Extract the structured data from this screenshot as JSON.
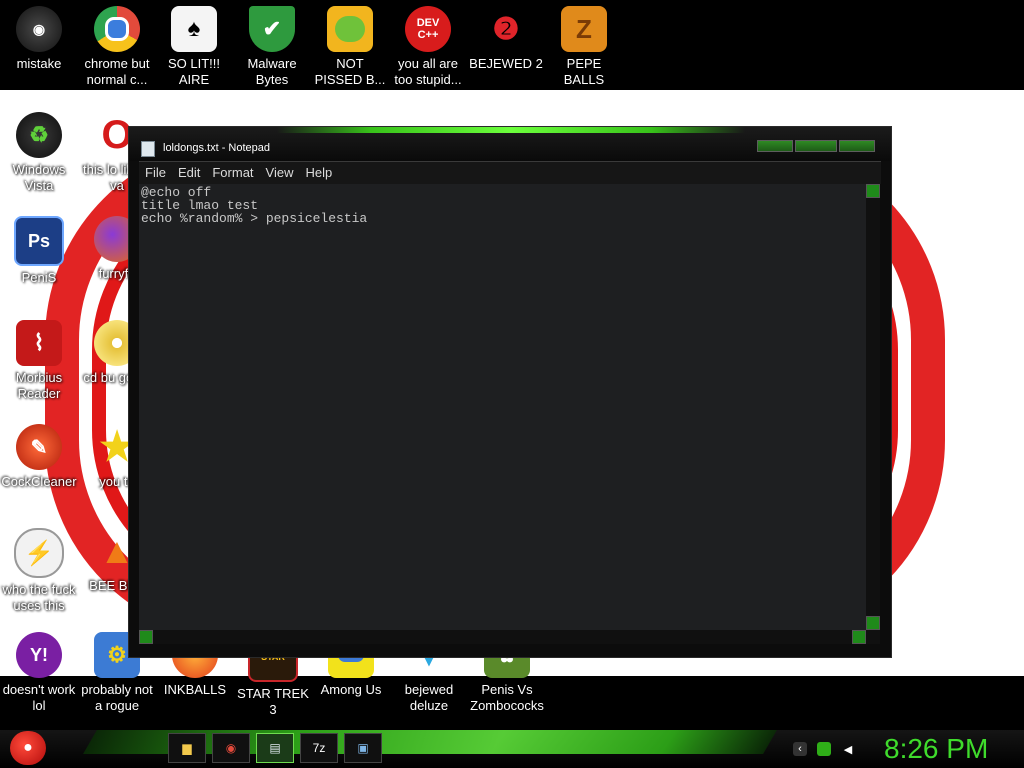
{
  "desktop": {
    "top_row": [
      {
        "label": "mistake",
        "icon": "dark-sphere-icon",
        "color": "#3a3a3a"
      },
      {
        "label": "chrome but normal c...",
        "icon": "chrome-icon",
        "color": "#e24a3b"
      },
      {
        "label": "SO LIT!!! AIRE",
        "icon": "solitaire-card-icon",
        "color": "#ffffff"
      },
      {
        "label": "Malware Bytes",
        "icon": "shield-check-icon",
        "color": "#2e9a3e"
      },
      {
        "label": "NOT PISSED B...",
        "icon": "angry-pig-icon",
        "color": "#f2b51e"
      },
      {
        "label": "you all are too stupid...",
        "icon": "devcpp-icon",
        "color": "#d81c1c"
      },
      {
        "label": "BEJEWED 2",
        "icon": "bejeweled-gem-icon",
        "color": "#2d66d1"
      },
      {
        "label": "PEPE BALLS",
        "icon": "zuma-icon",
        "color": "#e08a1b"
      }
    ],
    "left_col": [
      {
        "label": "Windows Vista",
        "icon": "recycle-bin-icon",
        "color": "#2f2f2f"
      },
      {
        "label": "PeniS",
        "icon": "photoshop-icon",
        "color": "#1c3e86"
      },
      {
        "label": "Morbius Reader",
        "icon": "acrobat-icon",
        "color": "#c41919"
      },
      {
        "label": "CockCleaner",
        "icon": "ccleaner-icon",
        "color": "#d93a1c"
      },
      {
        "label": "who the fuck uses this",
        "icon": "flash-icon",
        "color": "#e8e8e8"
      }
    ],
    "second_col": [
      {
        "label": "this lo like a va",
        "icon": "opera-icon",
        "color": "#d51b1b"
      },
      {
        "label": "furryfo",
        "icon": "firefox-icon",
        "color": "#e56a17"
      },
      {
        "label": "cd bu golde",
        "icon": "cd-icon",
        "color": "#e6c23b"
      },
      {
        "label": "you tri",
        "icon": "star-icon",
        "color": "#f2d21b"
      },
      {
        "label": "BEE BEE",
        "icon": "vlc-cone-icon",
        "color": "#f07b16"
      }
    ],
    "bottom_row": [
      {
        "label": "doesn't work lol",
        "icon": "yahoo-icon",
        "color": "#7a1fa3"
      },
      {
        "label": "probably not a rogue",
        "icon": "gear-monitor-icon",
        "color": "#3c7bd4"
      },
      {
        "label": "INKBALLS",
        "icon": "inkball-icon",
        "color": "#e23b1b"
      },
      {
        "label": "STAR TREK 3",
        "icon": "star-trek-icon",
        "color": "#c8262a"
      },
      {
        "label": "Among Us",
        "icon": "among-us-icon",
        "color": "#3d7ad6"
      },
      {
        "label": "bejewed deluze",
        "icon": "gem-icon",
        "color": "#2aa8e0"
      },
      {
        "label": "Penis Vs Zombococks",
        "icon": "zombie-plant-icon",
        "color": "#5a8a2a"
      }
    ]
  },
  "notepad": {
    "title": "loldongs.txt - Notepad",
    "menu": [
      "File",
      "Edit",
      "Format",
      "View",
      "Help"
    ],
    "content": "@echo off\ntitle lmao test\necho %random% > pepsicelestia"
  },
  "taskbar": {
    "clock": "8:26 PM",
    "accent": "#3fdc2c"
  }
}
